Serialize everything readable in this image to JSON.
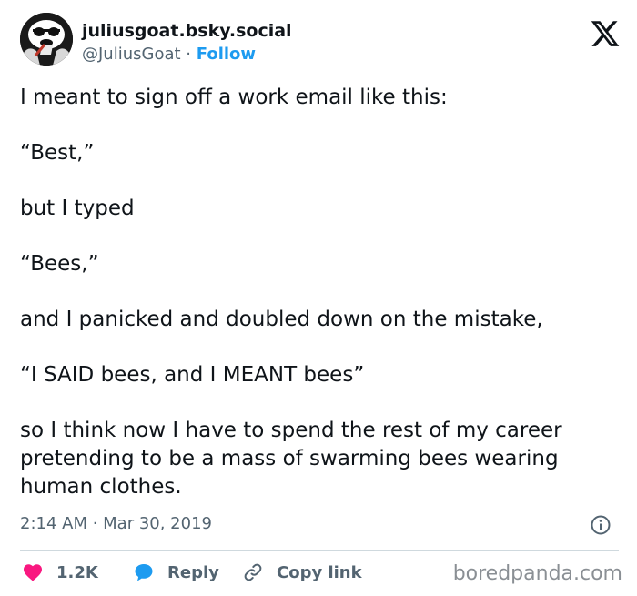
{
  "author": {
    "display_name": "juliusgoat.bsky.social",
    "handle": "@JuliusGoat",
    "separator": "·",
    "follow_label": "Follow"
  },
  "tweet": {
    "paragraphs": [
      "I meant to sign off a work email like this:",
      "“Best,”",
      "but I typed",
      "“Bees,”",
      "and I panicked and doubled down on the mistake,",
      "“I SAID bees, and I MEANT bees”",
      "so I think now I have to spend the rest of my career pretending to be a mass of swarming bees wearing human clothes."
    ],
    "timestamp": "2:14 AM · Mar 30, 2019"
  },
  "actions": {
    "like_count": "1.2K",
    "reply_label": "Reply",
    "copy_label": "Copy link"
  },
  "watermark": "boredpanda.com",
  "icons": {
    "brand": "x-logo-icon",
    "like": "heart-icon",
    "reply": "speech-bubble-icon",
    "copy": "link-icon",
    "info": "info-icon"
  },
  "colors": {
    "like": "#f91880",
    "reply": "#1d9bf0",
    "follow": "#1d9bf0",
    "muted_text": "#536471",
    "divider": "#cfd9de"
  }
}
